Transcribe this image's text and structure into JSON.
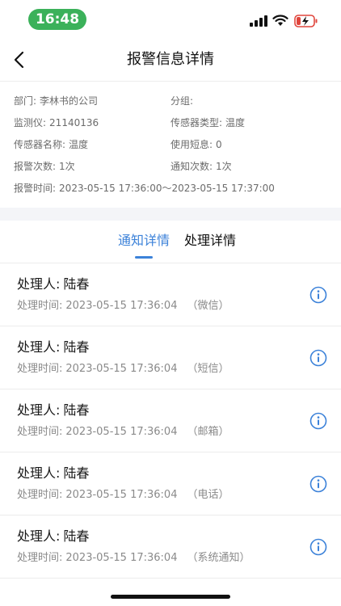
{
  "status_bar": {
    "time": "16:48"
  },
  "nav": {
    "title": "报警信息详情"
  },
  "info": {
    "department_label": "部门:",
    "department_value": "李林书的公司",
    "group_label": "分组:",
    "group_value": "",
    "monitor_label": "监测仪:",
    "monitor_value": "21140136",
    "sensor_type_label": "传感器类型:",
    "sensor_type_value": "温度",
    "sensor_name_label": "传感器名称:",
    "sensor_name_value": "温度",
    "sms_used_label": "使用短息:",
    "sms_used_value": "0",
    "alarm_count_label": "报警次数:",
    "alarm_count_value": "1次",
    "notify_count_label": "通知次数:",
    "notify_count_value": "1次",
    "alarm_time_label": "报警时间:",
    "alarm_time_value": "2023-05-15 17:36:00～2023-05-15 17:37:00"
  },
  "tabs": {
    "notify": "通知详情",
    "process": "处理详情"
  },
  "records": {
    "handler_label": "处理人:",
    "time_label": "处理时间:",
    "items": [
      {
        "name": "陆春",
        "time": "2023-05-15 17:36:04",
        "channel": "（微信）"
      },
      {
        "name": "陆春",
        "time": "2023-05-15 17:36:04",
        "channel": "（短信）"
      },
      {
        "name": "陆春",
        "time": "2023-05-15 17:36:04",
        "channel": "（邮箱）"
      },
      {
        "name": "陆春",
        "time": "2023-05-15 17:36:04",
        "channel": "（电话）"
      },
      {
        "name": "陆春",
        "time": "2023-05-15 17:36:04",
        "channel": "（系统通知）"
      }
    ]
  },
  "colors": {
    "accent": "#3c82d9",
    "status_pill": "#3bb15a",
    "battery_low": "#e0453c"
  }
}
